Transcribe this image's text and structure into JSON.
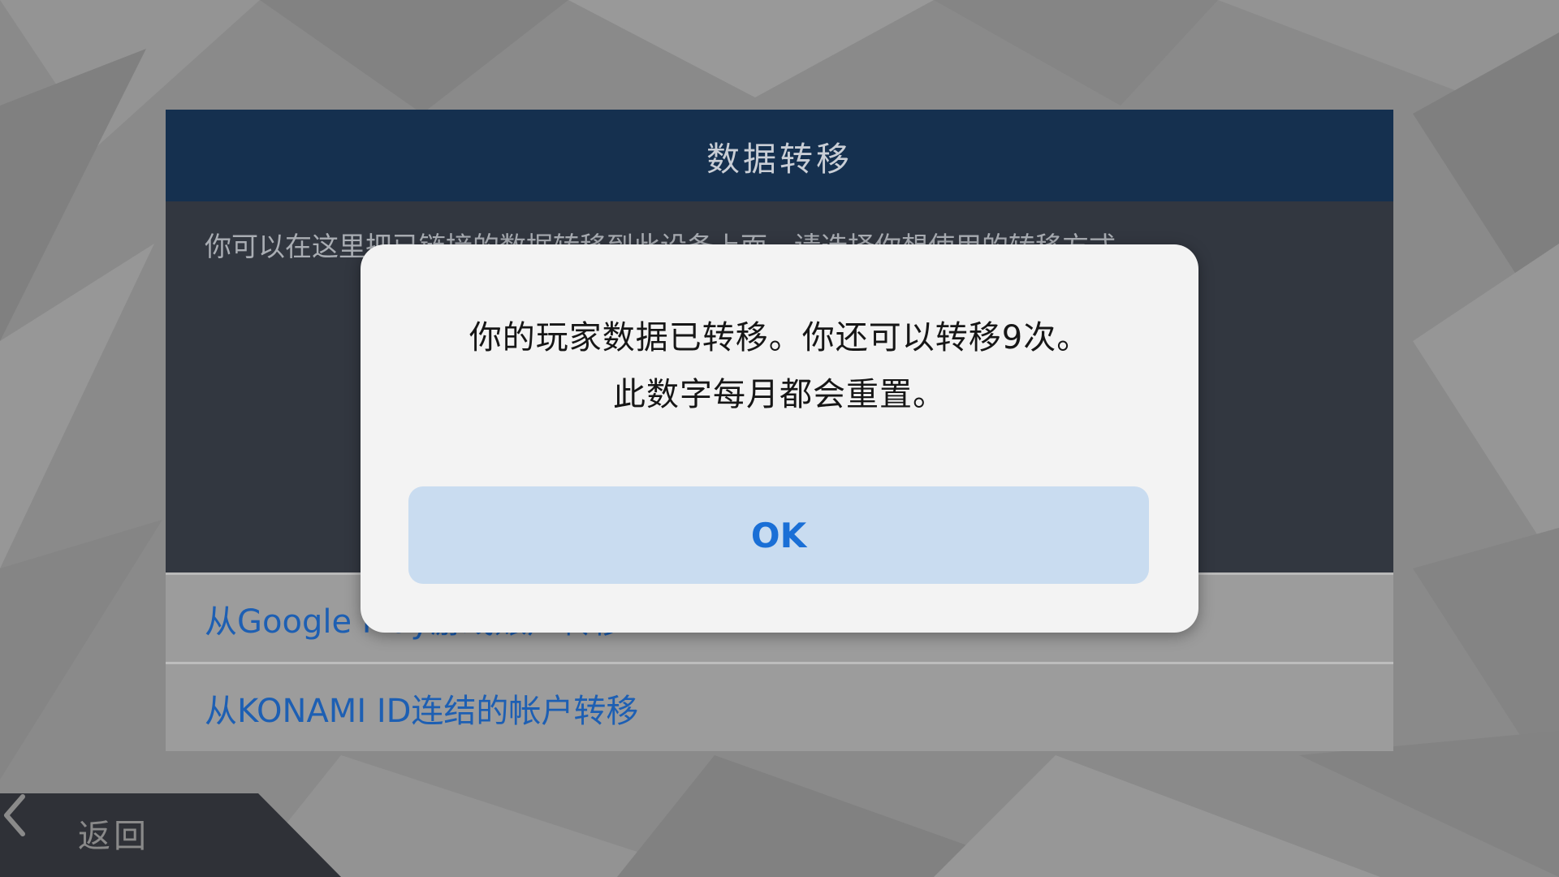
{
  "panel": {
    "title": "数据转移",
    "description": "你可以在这里把已链接的数据转移到此设备上面。请选择你想使用的转移方式。",
    "options": [
      {
        "label": "从Google Play游戏账户转移"
      },
      {
        "label": "从KONAMI ID连结的帐户转移"
      }
    ]
  },
  "back": {
    "label": "返回"
  },
  "dialog": {
    "message_line1": "你的玩家数据已转移。你还可以转移9次。",
    "message_line2": "此数字每月都会重置。",
    "ok_label": "OK"
  },
  "colors": {
    "header_bg": "#15304f",
    "body_bg": "#323740",
    "option_text": "#1d5fb3",
    "ok_bg": "#c9dcf0",
    "ok_text": "#1a6fd6"
  }
}
